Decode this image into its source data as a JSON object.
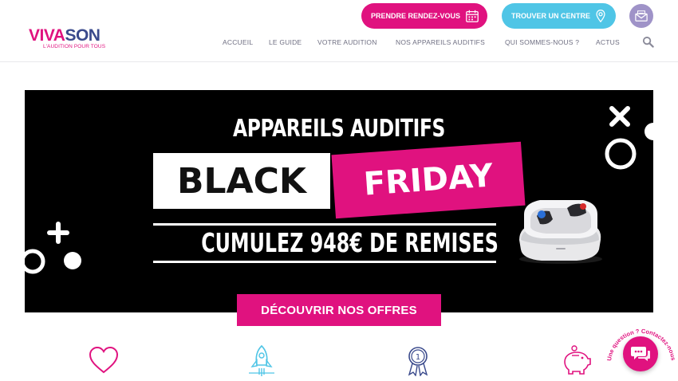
{
  "brand": {
    "logo_part1": "VIVA",
    "logo_part2": "SON",
    "tagline": "L'AUDITION POUR TOUS",
    "pink": "#e0127f",
    "navy": "#3a4a8c",
    "cyan": "#4fc5e6",
    "lavender": "#9f93c8"
  },
  "header": {
    "cta_rdv": {
      "label": "PRENDRE RENDEZ-VOUS",
      "icon": "calendar-icon"
    },
    "cta_centre": {
      "label": "TROUVER UN CENTRE",
      "icon": "map-pin-icon"
    },
    "mail_icon": "envelope-icon",
    "nav": [
      "ACCUEIL",
      "LE GUIDE",
      "VOTRE AUDITION",
      "NOS APPAREILS AUDITIFS",
      "QUI SOMMES-NOUS ?",
      "ACTUS"
    ],
    "search_icon": "search-icon"
  },
  "banner": {
    "title": "APPAREILS AUDITIFS",
    "word_black": "BLACK",
    "word_friday": "FRIDAY",
    "promo": "CUMULEZ 948€ DE REMISES"
  },
  "offer_button": "DÉCOUVRIR NOS OFFRES",
  "features": [
    "heart-icon",
    "rocket-icon",
    "medal-icon",
    "piggy-bank-icon"
  ],
  "contact": {
    "circle_text": "Une question ? Contactez-nous",
    "icon": "chat-icon"
  }
}
